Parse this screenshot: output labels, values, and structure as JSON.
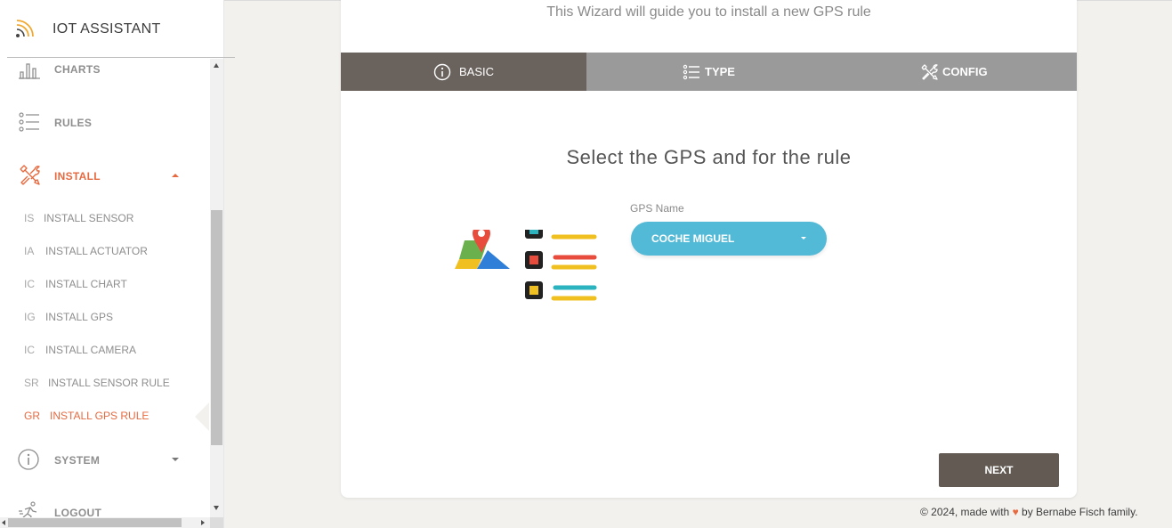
{
  "app": {
    "title": "IOT ASSISTANT"
  },
  "sidebar": {
    "items": [
      {
        "label": "CHARTS",
        "icon": "bar-chart-icon"
      },
      {
        "label": "RULES",
        "icon": "list-icon"
      },
      {
        "label": "INSTALL",
        "icon": "tools-icon",
        "expanded": true
      },
      {
        "label": "SYSTEM",
        "icon": "info-icon",
        "expanded": false
      },
      {
        "label": "LOGOUT",
        "icon": "running-person-icon"
      }
    ],
    "install_sub": [
      {
        "abbr": "IS",
        "label": "INSTALL SENSOR"
      },
      {
        "abbr": "IA",
        "label": "INSTALL ACTUATOR"
      },
      {
        "abbr": "IC",
        "label": "INSTALL CHART"
      },
      {
        "abbr": "IG",
        "label": "INSTALL GPS"
      },
      {
        "abbr": "IC",
        "label": "INSTALL CAMERA"
      },
      {
        "abbr": "SR",
        "label": "INSTALL SENSOR RULE"
      },
      {
        "abbr": "GR",
        "label": "INSTALL GPS RULE",
        "active": true
      }
    ]
  },
  "wizard": {
    "subtitle": "This Wizard will guide you to install a new GPS rule",
    "tabs": [
      {
        "label": "BASIC",
        "icon": "info-icon",
        "active": true
      },
      {
        "label": "TYPE",
        "icon": "list-icon"
      },
      {
        "label": "CONFIG",
        "icon": "tools-icon"
      }
    ],
    "step_title": "Select the GPS and for the rule",
    "gps_field": {
      "label": "GPS Name",
      "value": "COCHE MIGUEL"
    },
    "next_label": "NEXT"
  },
  "footer": {
    "prefix": "© 2024, made with",
    "heart": "♥",
    "suffix": "by Bernabe Fisch family."
  },
  "colors": {
    "accent": "#e66a40",
    "tab_active": "#6a625c",
    "tab_bar": "#9a9a9a",
    "dropdown": "#52b9d6",
    "next_button": "#625a53"
  }
}
